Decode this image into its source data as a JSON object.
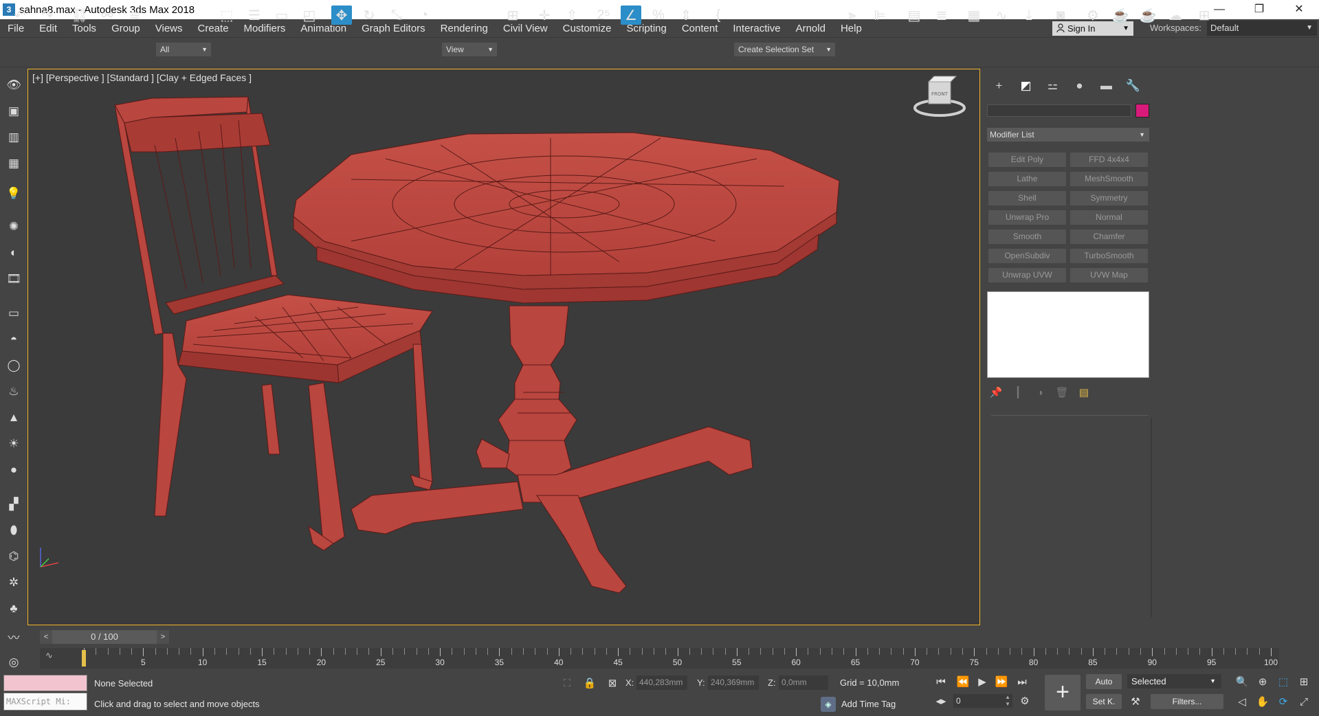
{
  "window": {
    "title": "sahna8.max - Autodesk 3ds Max 2018",
    "app_icon_glyph": "3",
    "minimize_glyph": "—",
    "maximize_glyph": "❐",
    "close_glyph": "✕"
  },
  "menu": {
    "items": [
      "File",
      "Edit",
      "Tools",
      "Group",
      "Views",
      "Create",
      "Modifiers",
      "Animation",
      "Graph Editors",
      "Rendering",
      "Civil View",
      "Customize",
      "Scripting",
      "Content",
      "Interactive",
      "Arnold",
      "Help"
    ]
  },
  "account": {
    "sign_in": "Sign In"
  },
  "workspace": {
    "label": "Workspaces:",
    "value": "Default"
  },
  "toolbar": {
    "selection_filter": "All",
    "reference_coord": "View",
    "selection_set": "Create Selection Set",
    "icons": [
      "undo-icon",
      "redo-icon",
      "link-icon",
      "unlink-icon",
      "bind-spacewarp-icon",
      "select-object-icon",
      "select-by-name-icon",
      "rect-region-icon",
      "window-crossing-icon",
      "select-move-icon",
      "select-rotate-icon",
      "select-scale-icon",
      "select-place-icon",
      "pivot-icon",
      "mirror-icon",
      "align-icon",
      "snap-toggle-icon",
      "angle-snap-icon",
      "percent-snap-icon",
      "spinner-snap-icon",
      "edit-named-sets-icon",
      "layer-explorer-icon",
      "toggle-ribbon-icon",
      "curve-editor-icon",
      "schematic-view-icon",
      "material-editor-icon",
      "render-setup-icon",
      "rendered-frame-icon",
      "render-icon",
      "render-cloud-icon",
      "a360-gallery-icon"
    ]
  },
  "viewport": {
    "label": "[+] [Perspective ] [Standard ] [Clay + Edged Faces ]",
    "viewcube_label": "FRONT",
    "model_color": "#b9463f",
    "border_color": "#f0b428"
  },
  "command_panel": {
    "tabs": [
      "create-tab",
      "modify-tab",
      "hierarchy-tab",
      "motion-tab",
      "display-tab",
      "utilities-tab"
    ],
    "object_color": "#d81b7a",
    "modifier_list": "Modifier List",
    "modifier_buttons": [
      "Edit Poly",
      "FFD 4x4x4",
      "Lathe",
      "MeshSmooth",
      "Shell",
      "Symmetry",
      "Unwrap Pro",
      "Normal",
      "Smooth",
      "Chamfer",
      "OpenSubdiv",
      "TurboSmooth",
      "Unwrap UVW",
      "UVW Map"
    ]
  },
  "time_slider": {
    "value": "0 / 100",
    "prev": "<",
    "next": ">"
  },
  "track_bar": {
    "ticks": [
      "5",
      "10",
      "15",
      "20",
      "25",
      "30",
      "35",
      "40",
      "45",
      "50",
      "55",
      "60",
      "65",
      "70",
      "75",
      "80",
      "85",
      "90",
      "95",
      "100"
    ]
  },
  "status": {
    "maxscript_placeholder": "MAXScript Mi:",
    "selection": "None Selected",
    "prompt": "Click and drag to select and move objects",
    "x_label": "X:",
    "x_value": "440,283mm",
    "y_label": "Y:",
    "y_value": "240,369mm",
    "z_label": "Z:",
    "z_value": "0,0mm",
    "grid": "Grid = 10,0mm",
    "add_time_tag": "Add Time Tag",
    "frame": "0",
    "auto_key": "Auto",
    "set_key": "Set K.",
    "key_mode": "Selected",
    "filters": "Filters..."
  }
}
